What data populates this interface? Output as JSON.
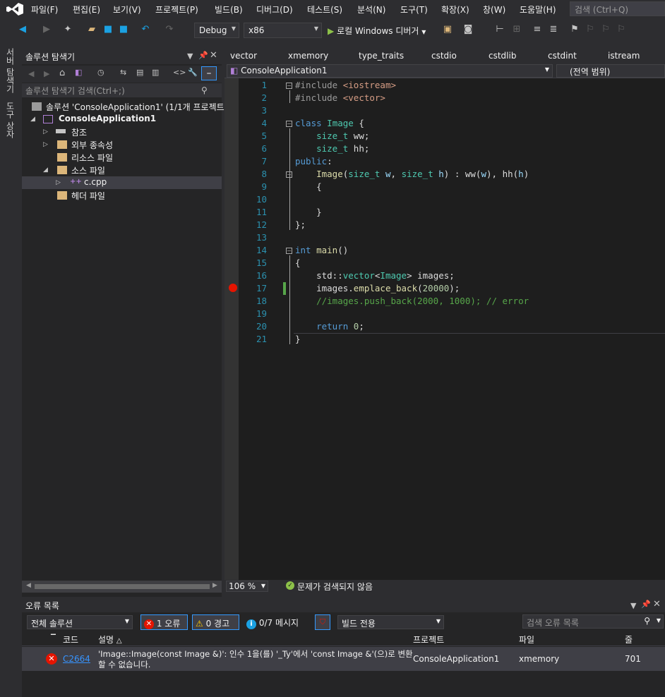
{
  "menu": [
    "파일(F)",
    "편집(E)",
    "보기(V)",
    "프로젝트(P)",
    "빌드(B)",
    "디버그(D)",
    "테스트(S)",
    "분석(N)",
    "도구(T)",
    "확장(X)",
    "창(W)",
    "도움말(H)"
  ],
  "quick_search_placeholder": "검색 (Ctrl+Q)",
  "toolbar": {
    "config": "Debug",
    "platform": "x86",
    "run_label": "로컬 Windows 디버거"
  },
  "left_tabs": [
    "서버 탐색기",
    "도구 상자"
  ],
  "solution_explorer": {
    "title": "솔루션 탐색기",
    "search_placeholder": "솔루션 탐색기 검색(Ctrl+;)",
    "tree": [
      {
        "label": "솔루션 'ConsoleApplication1' (1/1개 프로젝트",
        "icon": "solution-icon"
      },
      {
        "label": "ConsoleApplication1",
        "icon": "project-icon"
      },
      {
        "label": "참조",
        "icon": "references-icon"
      },
      {
        "label": "외부 종속성",
        "icon": "folder-icon"
      },
      {
        "label": "리소스 파일",
        "icon": "folder-icon"
      },
      {
        "label": "소스 파일",
        "icon": "folder-icon"
      },
      {
        "label": "c.cpp",
        "icon": "cpp-file-icon"
      },
      {
        "label": "헤더 파일",
        "icon": "folder-icon"
      }
    ]
  },
  "editor": {
    "tabs": [
      "vector",
      "xmemory",
      "type_traits",
      "cstdio",
      "cstdlib",
      "cstdint",
      "istream"
    ],
    "nav_project": "ConsoleApplication1",
    "nav_scope": "(전역 범위)",
    "line_numbers": [
      "1",
      "2",
      "3",
      "4",
      "5",
      "6",
      "7",
      "8",
      "9",
      "10",
      "11",
      "12",
      "13",
      "14",
      "15",
      "16",
      "17",
      "18",
      "19",
      "20",
      "21"
    ],
    "zoom": "106 %",
    "status": "문제가 검색되지 않음"
  },
  "error_list": {
    "title": "오류 목록",
    "scope": "전체 솔루션",
    "errors_btn": "1 오류",
    "warnings_btn": "0 경고",
    "messages_btn": "0/7 메시지",
    "build_filter": "빌드 전용",
    "search_placeholder": "검색 오류 목록",
    "columns": {
      "code": "코드",
      "desc": "설명",
      "project": "프로젝트",
      "file": "파일",
      "line": "줄"
    },
    "rows": [
      {
        "code": "C2664",
        "desc1": "'Image::Image(const Image &)': 인수 1을(를) '_Ty'에서 'const Image &'(으)로 변환",
        "desc2": "할 수 없습니다.",
        "project": "ConsoleApplication1",
        "file": "xmemory",
        "line": "701"
      }
    ]
  },
  "colors": {
    "accent": "#007acc",
    "error": "#e51400",
    "warning": "#ffcc00",
    "info": "#1ba1e2"
  }
}
